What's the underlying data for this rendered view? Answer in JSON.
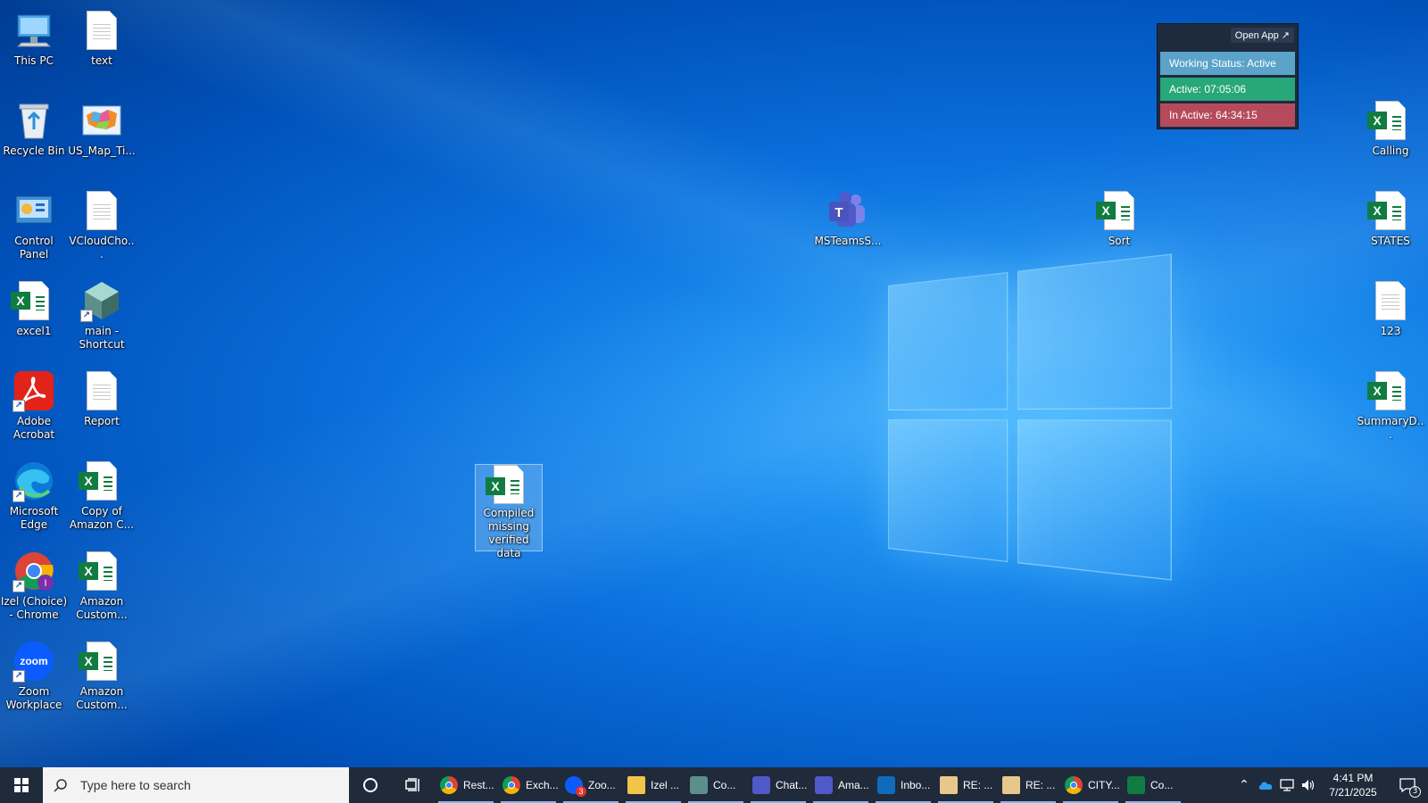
{
  "desktop": {
    "left_icons": [
      {
        "label": "This PC",
        "icon": "computer-icon"
      },
      {
        "label": "text",
        "icon": "text-file-icon"
      },
      {
        "label": "Recycle Bin",
        "icon": "recycle-bin-icon"
      },
      {
        "label": "US_Map_Ti...",
        "icon": "map-image-icon"
      },
      {
        "label": "Control Panel",
        "icon": "control-panel-icon"
      },
      {
        "label": "VCloudCho...",
        "icon": "text-file-icon"
      },
      {
        "label": "excel1",
        "icon": "excel-file-icon"
      },
      {
        "label": "main - Shortcut",
        "icon": "app-shortcut-icon"
      },
      {
        "label": "Adobe Acrobat",
        "icon": "acrobat-icon"
      },
      {
        "label": "Report",
        "icon": "text-file-icon"
      },
      {
        "label": "Microsoft Edge",
        "icon": "edge-icon"
      },
      {
        "label": "Copy of Amazon C...",
        "icon": "excel-file-icon"
      },
      {
        "label": "Izel (Choice) - Chrome",
        "icon": "chrome-icon"
      },
      {
        "label": "Amazon Custom...",
        "icon": "excel-file-icon"
      },
      {
        "label": "Zoom Workplace",
        "icon": "zoom-icon"
      },
      {
        "label": "Amazon Custom...",
        "icon": "excel-file-icon"
      }
    ],
    "middle_icons": {
      "teams": {
        "label": "MSTeamsS...",
        "icon": "teams-icon"
      },
      "sort": {
        "label": "Sort",
        "icon": "excel-file-icon"
      },
      "compiled": {
        "label": "Compiled missing verified data",
        "icon": "excel-file-icon"
      }
    },
    "right_icons": [
      {
        "label": "Calling",
        "icon": "excel-file-icon"
      },
      {
        "label": "STATES",
        "icon": "excel-file-icon"
      },
      {
        "label": "123",
        "icon": "text-file-icon"
      },
      {
        "label": "SummaryD...",
        "icon": "excel-file-icon"
      }
    ]
  },
  "widget": {
    "open_app": "Open App ↗",
    "working_status": "Working Status: Active",
    "active": "Active: 07:05:06",
    "inactive": "In Active: 64:34:15",
    "colors": {
      "status": "#5ba3c9",
      "active": "#27a77a",
      "inactive": "#b64a5d"
    }
  },
  "taskbar": {
    "search_placeholder": "Type here to search",
    "apps": [
      {
        "label": "Rest...",
        "icon": "chrome-icon"
      },
      {
        "label": "Exch...",
        "icon": "chrome-icon"
      },
      {
        "label": "Zoo...",
        "icon": "zoom-icon",
        "badge": "3"
      },
      {
        "label": "Izel ...",
        "icon": "folder-icon"
      },
      {
        "label": "Co...",
        "icon": "app-icon"
      },
      {
        "label": "Chat...",
        "icon": "teams-icon"
      },
      {
        "label": "Ama...",
        "icon": "teams-icon"
      },
      {
        "label": "Inbo...",
        "icon": "outlook-icon"
      },
      {
        "label": "RE: ...",
        "icon": "mail-icon"
      },
      {
        "label": "RE: ...",
        "icon": "mail-icon"
      },
      {
        "label": "CITY...",
        "icon": "chrome-icon"
      },
      {
        "label": "Co...",
        "icon": "excel-icon"
      }
    ],
    "time": "4:41 PM",
    "date": "7/21/2025",
    "notification_count": "3"
  }
}
